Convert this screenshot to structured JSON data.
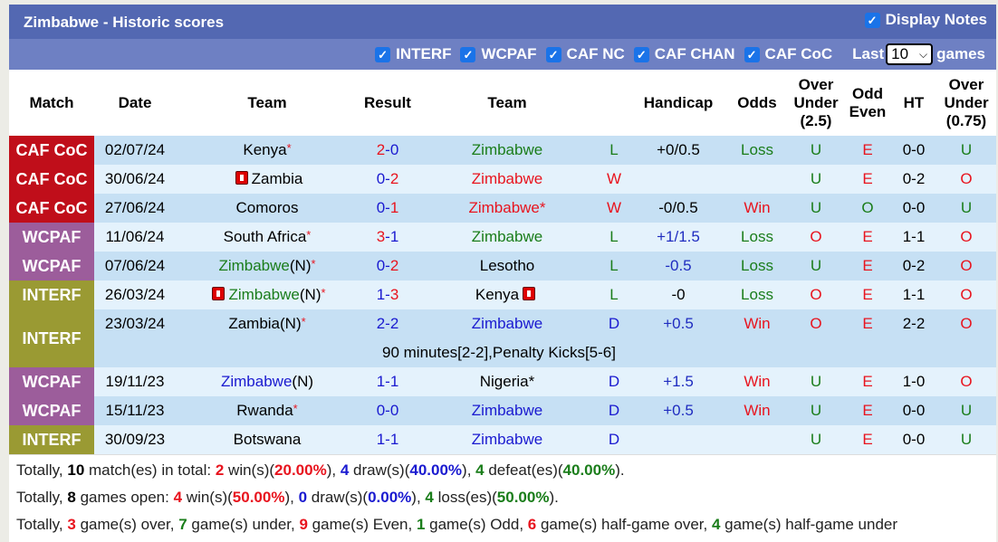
{
  "header": {
    "title": "Zimbabwe - Historic scores",
    "display_notes_label": "Display Notes",
    "display_notes_checked": true
  },
  "filters": {
    "items": [
      {
        "label": "INTERF",
        "checked": true
      },
      {
        "label": "WCPAF",
        "checked": true
      },
      {
        "label": "CAF NC",
        "checked": true
      },
      {
        "label": "CAF CHAN",
        "checked": true
      },
      {
        "label": "CAF CoC",
        "checked": true
      }
    ],
    "last_label": "Last",
    "last_value": "10",
    "games_label": "games"
  },
  "columns": {
    "match": "Match",
    "date": "Date",
    "team_home": "Team",
    "result": "Result",
    "team_away": "Team",
    "wl": "",
    "handicap": "Handicap",
    "odds": "Odds",
    "ou_line1": "Over",
    "ou_line2": "Under",
    "ou_line3": "(2.5)",
    "oe_line1": "Odd",
    "oe_line2": "Even",
    "ht": "HT",
    "ou2_line1": "Over",
    "ou2_line2": "Under",
    "ou2_line3": "(0.75)"
  },
  "rows": [
    {
      "comp": "CAF CoC",
      "date": "02/07/24",
      "home": "Kenya",
      "home_star": "*",
      "home_card": false,
      "home_color": "black",
      "score_h": "2",
      "score_a": "0",
      "sh_color": "red",
      "sa_color": "blue",
      "away": "Zimbabwe",
      "away_star": "",
      "away_card": false,
      "away_color": "green",
      "wl": "L",
      "wl_color": "green",
      "handicap": "+0/0.5",
      "hc_color": "black",
      "odds": "Loss",
      "odds_color": "green",
      "ou": "U",
      "ou_color": "green",
      "oe": "E",
      "oe_color": "red",
      "ht": "0-0",
      "ou2": "U",
      "ou2_color": "green"
    },
    {
      "comp": "CAF CoC",
      "date": "30/06/24",
      "home": "Zambia",
      "home_star": "",
      "home_card": true,
      "home_color": "black",
      "score_h": "0",
      "score_a": "2",
      "sh_color": "blue",
      "sa_color": "red",
      "away": "Zimbabwe",
      "away_star": "",
      "away_card": false,
      "away_color": "red",
      "wl": "W",
      "wl_color": "red",
      "handicap": "",
      "hc_color": "black",
      "odds": "",
      "odds_color": "black",
      "ou": "U",
      "ou_color": "green",
      "oe": "E",
      "oe_color": "red",
      "ht": "0-2",
      "ou2": "O",
      "ou2_color": "red"
    },
    {
      "comp": "CAF CoC",
      "date": "27/06/24",
      "home": "Comoros",
      "home_star": "",
      "home_card": false,
      "home_color": "black",
      "score_h": "0",
      "score_a": "1",
      "sh_color": "blue",
      "sa_color": "red",
      "away": "Zimbabwe",
      "away_star": "*",
      "away_card": false,
      "away_color": "red",
      "wl": "W",
      "wl_color": "red",
      "handicap": "-0/0.5",
      "hc_color": "black",
      "odds": "Win",
      "odds_color": "red",
      "ou": "U",
      "ou_color": "green",
      "oe": "O",
      "oe_color": "green",
      "ht": "0-0",
      "ou2": "U",
      "ou2_color": "green"
    },
    {
      "comp": "WCPAF",
      "date": "11/06/24",
      "home": "South Africa",
      "home_star": "*",
      "home_card": false,
      "home_color": "black",
      "score_h": "3",
      "score_a": "1",
      "sh_color": "red",
      "sa_color": "blue",
      "away": "Zimbabwe",
      "away_star": "",
      "away_card": false,
      "away_color": "green",
      "wl": "L",
      "wl_color": "green",
      "handicap": "+1/1.5",
      "hc_color": "dblue",
      "odds": "Loss",
      "odds_color": "green",
      "ou": "O",
      "ou_color": "red",
      "oe": "E",
      "oe_color": "red",
      "ht": "1-1",
      "ou2": "O",
      "ou2_color": "red"
    },
    {
      "comp": "WCPAF",
      "date": "07/06/24",
      "home": "Zimbabwe",
      "home_suffix": "(N)",
      "home_star": "*",
      "home_card": false,
      "home_color": "green",
      "score_h": "0",
      "score_a": "2",
      "sh_color": "blue",
      "sa_color": "red",
      "away": "Lesotho",
      "away_star": "",
      "away_card": false,
      "away_color": "black",
      "wl": "L",
      "wl_color": "green",
      "handicap": "-0.5",
      "hc_color": "dblue",
      "odds": "Loss",
      "odds_color": "green",
      "ou": "U",
      "ou_color": "green",
      "oe": "E",
      "oe_color": "red",
      "ht": "0-2",
      "ou2": "O",
      "ou2_color": "red"
    },
    {
      "comp": "INTERF",
      "date": "26/03/24",
      "home": "Zimbabwe",
      "home_suffix": "(N)",
      "home_star": "*",
      "home_card": true,
      "home_color": "green",
      "score_h": "1",
      "score_a": "3",
      "sh_color": "blue",
      "sa_color": "red",
      "away": "Kenya",
      "away_star": "",
      "away_card": true,
      "away_color": "black",
      "wl": "L",
      "wl_color": "green",
      "handicap": "-0",
      "hc_color": "black",
      "odds": "Loss",
      "odds_color": "green",
      "ou": "O",
      "ou_color": "red",
      "oe": "E",
      "oe_color": "red",
      "ht": "1-1",
      "ou2": "O",
      "ou2_color": "red"
    },
    {
      "comp": "INTERF",
      "date": "23/03/24",
      "home": "Zambia",
      "home_suffix": "(N)",
      "home_star": "*",
      "home_card": false,
      "home_color": "black",
      "score_h": "2",
      "score_a": "2",
      "sh_color": "blue",
      "sa_color": "blue",
      "away": "Zimbabwe",
      "away_star": "",
      "away_card": false,
      "away_color": "blue",
      "wl": "D",
      "wl_color": "blue",
      "handicap": "+0.5",
      "hc_color": "dblue",
      "odds": "Win",
      "odds_color": "red",
      "ou": "O",
      "ou_color": "red",
      "oe": "E",
      "oe_color": "red",
      "ht": "2-2",
      "ou2": "O",
      "ou2_color": "red",
      "note": "90 minutes[2-2],Penalty Kicks[5-6]"
    },
    {
      "comp": "WCPAF",
      "date": "19/11/23",
      "home": "Zimbabwe",
      "home_suffix": "(N)",
      "home_star": "",
      "home_card": false,
      "home_color": "blue",
      "score_h": "1",
      "score_a": "1",
      "sh_color": "blue",
      "sa_color": "blue",
      "away": "Nigeria",
      "away_star": "*",
      "away_card": false,
      "away_color": "black",
      "wl": "D",
      "wl_color": "blue",
      "handicap": "+1.5",
      "hc_color": "dblue",
      "odds": "Win",
      "odds_color": "red",
      "ou": "U",
      "ou_color": "green",
      "oe": "E",
      "oe_color": "red",
      "ht": "1-0",
      "ou2": "O",
      "ou2_color": "red"
    },
    {
      "comp": "WCPAF",
      "date": "15/11/23",
      "home": "Rwanda",
      "home_star": "*",
      "home_card": false,
      "home_color": "black",
      "score_h": "0",
      "score_a": "0",
      "sh_color": "blue",
      "sa_color": "blue",
      "away": "Zimbabwe",
      "away_star": "",
      "away_card": false,
      "away_color": "blue",
      "wl": "D",
      "wl_color": "blue",
      "handicap": "+0.5",
      "hc_color": "dblue",
      "odds": "Win",
      "odds_color": "red",
      "ou": "U",
      "ou_color": "green",
      "oe": "E",
      "oe_color": "red",
      "ht": "0-0",
      "ou2": "U",
      "ou2_color": "green"
    },
    {
      "comp": "INTERF",
      "date": "30/09/23",
      "home": "Botswana",
      "home_star": "",
      "home_card": false,
      "home_color": "black",
      "score_h": "1",
      "score_a": "1",
      "sh_color": "blue",
      "sa_color": "blue",
      "away": "Zimbabwe",
      "away_star": "",
      "away_card": false,
      "away_color": "blue",
      "wl": "D",
      "wl_color": "blue",
      "handicap": "",
      "hc_color": "black",
      "odds": "",
      "odds_color": "black",
      "ou": "U",
      "ou_color": "green",
      "oe": "E",
      "oe_color": "red",
      "ht": "0-0",
      "ou2": "U",
      "ou2_color": "green"
    }
  ],
  "summary": {
    "line1": [
      {
        "t": "Totally, "
      },
      {
        "t": "10",
        "c": "black",
        "b": true
      },
      {
        "t": " match(es) in total: "
      },
      {
        "t": "2",
        "c": "red",
        "b": true
      },
      {
        "t": " win(s)("
      },
      {
        "t": "20.00%",
        "c": "red",
        "b": true
      },
      {
        "t": "), "
      },
      {
        "t": "4",
        "c": "blue",
        "b": true
      },
      {
        "t": " draw(s)("
      },
      {
        "t": "40.00%",
        "c": "blue",
        "b": true
      },
      {
        "t": "), "
      },
      {
        "t": "4",
        "c": "green",
        "b": true
      },
      {
        "t": " defeat(es)("
      },
      {
        "t": "40.00%",
        "c": "green",
        "b": true
      },
      {
        "t": ")."
      }
    ],
    "line2": [
      {
        "t": "Totally, "
      },
      {
        "t": "8",
        "c": "black",
        "b": true
      },
      {
        "t": " games open: "
      },
      {
        "t": "4",
        "c": "red",
        "b": true
      },
      {
        "t": " win(s)("
      },
      {
        "t": "50.00%",
        "c": "red",
        "b": true
      },
      {
        "t": "), "
      },
      {
        "t": "0",
        "c": "blue",
        "b": true
      },
      {
        "t": " draw(s)("
      },
      {
        "t": "0.00%",
        "c": "blue",
        "b": true
      },
      {
        "t": "), "
      },
      {
        "t": "4",
        "c": "green",
        "b": true
      },
      {
        "t": " loss(es)("
      },
      {
        "t": "50.00%",
        "c": "green",
        "b": true
      },
      {
        "t": ")."
      }
    ],
    "line3": [
      {
        "t": "Totally, "
      },
      {
        "t": "3",
        "c": "red",
        "b": true
      },
      {
        "t": " game(s) over, "
      },
      {
        "t": "7",
        "c": "green",
        "b": true
      },
      {
        "t": " game(s) under, "
      },
      {
        "t": "9",
        "c": "red",
        "b": true
      },
      {
        "t": " game(s) Even, "
      },
      {
        "t": "1",
        "c": "green",
        "b": true
      },
      {
        "t": " game(s) Odd, "
      },
      {
        "t": "6",
        "c": "red",
        "b": true
      },
      {
        "t": " game(s) half-game over, "
      },
      {
        "t": "4",
        "c": "green",
        "b": true
      },
      {
        "t": " game(s) half-game under"
      }
    ]
  }
}
